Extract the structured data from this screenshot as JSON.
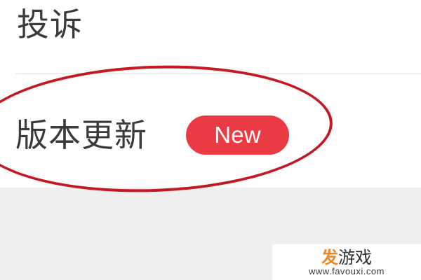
{
  "menu": {
    "complaint_label": "投诉",
    "version_update_label": "版本更新",
    "new_badge": "New"
  },
  "watermark": {
    "accent_text": "发",
    "main_text": "游戏",
    "url": "www.favouxi.com"
  },
  "colors": {
    "badge": "#ea3b45",
    "annotation_circle": "#c41822",
    "watermark_accent": "#f38522",
    "background": "#efefef",
    "card": "#ffffff",
    "text": "#3a3a3a"
  }
}
